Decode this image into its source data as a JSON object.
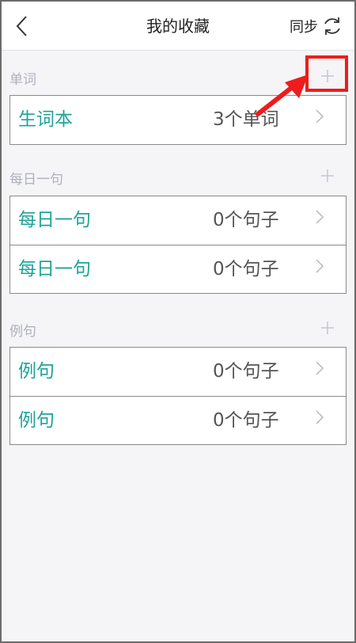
{
  "header": {
    "back_icon": "chevron-left-icon",
    "title": "我的收藏",
    "sync_label": "同步",
    "sync_icon": "refresh-icon"
  },
  "sections": [
    {
      "title": "单词",
      "add_icon": "plus-icon",
      "rows": [
        {
          "name": "生词本",
          "count": "3个单词"
        }
      ]
    },
    {
      "title": "每日一句",
      "add_icon": "plus-icon",
      "rows": [
        {
          "name": "每日一句",
          "count": "0个句子"
        },
        {
          "name": "每日一句",
          "count": "0个句子"
        }
      ]
    },
    {
      "title": "例句",
      "add_icon": "plus-icon",
      "rows": [
        {
          "name": "例句",
          "count": "0个句子"
        },
        {
          "name": "例句",
          "count": "0个句子"
        }
      ]
    }
  ],
  "annotation": {
    "highlight_color": "#ee1c1c",
    "arrow_color": "#ee1c1c"
  },
  "colors": {
    "accent": "#1fa39a",
    "section_title": "#aeb0be",
    "background": "#f5f5f7"
  }
}
